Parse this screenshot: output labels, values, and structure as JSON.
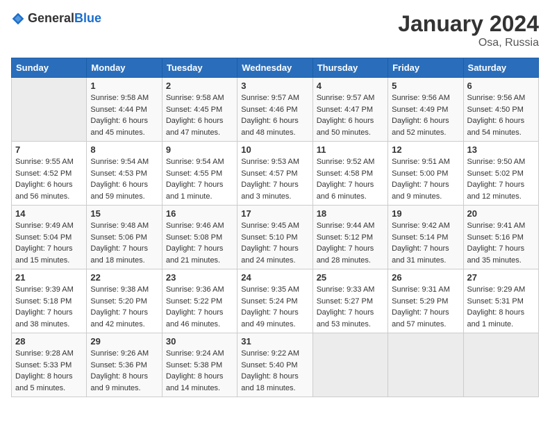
{
  "header": {
    "logo_general": "General",
    "logo_blue": "Blue",
    "title": "January 2024",
    "subtitle": "Osa, Russia"
  },
  "weekdays": [
    "Sunday",
    "Monday",
    "Tuesday",
    "Wednesday",
    "Thursday",
    "Friday",
    "Saturday"
  ],
  "weeks": [
    [
      {
        "day": "",
        "sunrise": "",
        "sunset": "",
        "daylight": ""
      },
      {
        "day": "1",
        "sunrise": "Sunrise: 9:58 AM",
        "sunset": "Sunset: 4:44 PM",
        "daylight": "Daylight: 6 hours and 45 minutes."
      },
      {
        "day": "2",
        "sunrise": "Sunrise: 9:58 AM",
        "sunset": "Sunset: 4:45 PM",
        "daylight": "Daylight: 6 hours and 47 minutes."
      },
      {
        "day": "3",
        "sunrise": "Sunrise: 9:57 AM",
        "sunset": "Sunset: 4:46 PM",
        "daylight": "Daylight: 6 hours and 48 minutes."
      },
      {
        "day": "4",
        "sunrise": "Sunrise: 9:57 AM",
        "sunset": "Sunset: 4:47 PM",
        "daylight": "Daylight: 6 hours and 50 minutes."
      },
      {
        "day": "5",
        "sunrise": "Sunrise: 9:56 AM",
        "sunset": "Sunset: 4:49 PM",
        "daylight": "Daylight: 6 hours and 52 minutes."
      },
      {
        "day": "6",
        "sunrise": "Sunrise: 9:56 AM",
        "sunset": "Sunset: 4:50 PM",
        "daylight": "Daylight: 6 hours and 54 minutes."
      }
    ],
    [
      {
        "day": "7",
        "sunrise": "Sunrise: 9:55 AM",
        "sunset": "Sunset: 4:52 PM",
        "daylight": "Daylight: 6 hours and 56 minutes."
      },
      {
        "day": "8",
        "sunrise": "Sunrise: 9:54 AM",
        "sunset": "Sunset: 4:53 PM",
        "daylight": "Daylight: 6 hours and 59 minutes."
      },
      {
        "day": "9",
        "sunrise": "Sunrise: 9:54 AM",
        "sunset": "Sunset: 4:55 PM",
        "daylight": "Daylight: 7 hours and 1 minute."
      },
      {
        "day": "10",
        "sunrise": "Sunrise: 9:53 AM",
        "sunset": "Sunset: 4:57 PM",
        "daylight": "Daylight: 7 hours and 3 minutes."
      },
      {
        "day": "11",
        "sunrise": "Sunrise: 9:52 AM",
        "sunset": "Sunset: 4:58 PM",
        "daylight": "Daylight: 7 hours and 6 minutes."
      },
      {
        "day": "12",
        "sunrise": "Sunrise: 9:51 AM",
        "sunset": "Sunset: 5:00 PM",
        "daylight": "Daylight: 7 hours and 9 minutes."
      },
      {
        "day": "13",
        "sunrise": "Sunrise: 9:50 AM",
        "sunset": "Sunset: 5:02 PM",
        "daylight": "Daylight: 7 hours and 12 minutes."
      }
    ],
    [
      {
        "day": "14",
        "sunrise": "Sunrise: 9:49 AM",
        "sunset": "Sunset: 5:04 PM",
        "daylight": "Daylight: 7 hours and 15 minutes."
      },
      {
        "day": "15",
        "sunrise": "Sunrise: 9:48 AM",
        "sunset": "Sunset: 5:06 PM",
        "daylight": "Daylight: 7 hours and 18 minutes."
      },
      {
        "day": "16",
        "sunrise": "Sunrise: 9:46 AM",
        "sunset": "Sunset: 5:08 PM",
        "daylight": "Daylight: 7 hours and 21 minutes."
      },
      {
        "day": "17",
        "sunrise": "Sunrise: 9:45 AM",
        "sunset": "Sunset: 5:10 PM",
        "daylight": "Daylight: 7 hours and 24 minutes."
      },
      {
        "day": "18",
        "sunrise": "Sunrise: 9:44 AM",
        "sunset": "Sunset: 5:12 PM",
        "daylight": "Daylight: 7 hours and 28 minutes."
      },
      {
        "day": "19",
        "sunrise": "Sunrise: 9:42 AM",
        "sunset": "Sunset: 5:14 PM",
        "daylight": "Daylight: 7 hours and 31 minutes."
      },
      {
        "day": "20",
        "sunrise": "Sunrise: 9:41 AM",
        "sunset": "Sunset: 5:16 PM",
        "daylight": "Daylight: 7 hours and 35 minutes."
      }
    ],
    [
      {
        "day": "21",
        "sunrise": "Sunrise: 9:39 AM",
        "sunset": "Sunset: 5:18 PM",
        "daylight": "Daylight: 7 hours and 38 minutes."
      },
      {
        "day": "22",
        "sunrise": "Sunrise: 9:38 AM",
        "sunset": "Sunset: 5:20 PM",
        "daylight": "Daylight: 7 hours and 42 minutes."
      },
      {
        "day": "23",
        "sunrise": "Sunrise: 9:36 AM",
        "sunset": "Sunset: 5:22 PM",
        "daylight": "Daylight: 7 hours and 46 minutes."
      },
      {
        "day": "24",
        "sunrise": "Sunrise: 9:35 AM",
        "sunset": "Sunset: 5:24 PM",
        "daylight": "Daylight: 7 hours and 49 minutes."
      },
      {
        "day": "25",
        "sunrise": "Sunrise: 9:33 AM",
        "sunset": "Sunset: 5:27 PM",
        "daylight": "Daylight: 7 hours and 53 minutes."
      },
      {
        "day": "26",
        "sunrise": "Sunrise: 9:31 AM",
        "sunset": "Sunset: 5:29 PM",
        "daylight": "Daylight: 7 hours and 57 minutes."
      },
      {
        "day": "27",
        "sunrise": "Sunrise: 9:29 AM",
        "sunset": "Sunset: 5:31 PM",
        "daylight": "Daylight: 8 hours and 1 minute."
      }
    ],
    [
      {
        "day": "28",
        "sunrise": "Sunrise: 9:28 AM",
        "sunset": "Sunset: 5:33 PM",
        "daylight": "Daylight: 8 hours and 5 minutes."
      },
      {
        "day": "29",
        "sunrise": "Sunrise: 9:26 AM",
        "sunset": "Sunset: 5:36 PM",
        "daylight": "Daylight: 8 hours and 9 minutes."
      },
      {
        "day": "30",
        "sunrise": "Sunrise: 9:24 AM",
        "sunset": "Sunset: 5:38 PM",
        "daylight": "Daylight: 8 hours and 14 minutes."
      },
      {
        "day": "31",
        "sunrise": "Sunrise: 9:22 AM",
        "sunset": "Sunset: 5:40 PM",
        "daylight": "Daylight: 8 hours and 18 minutes."
      },
      {
        "day": "",
        "sunrise": "",
        "sunset": "",
        "daylight": ""
      },
      {
        "day": "",
        "sunrise": "",
        "sunset": "",
        "daylight": ""
      },
      {
        "day": "",
        "sunrise": "",
        "sunset": "",
        "daylight": ""
      }
    ]
  ]
}
